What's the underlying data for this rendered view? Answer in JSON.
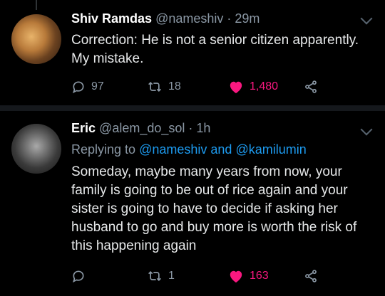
{
  "tweets": [
    {
      "name": "Shiv Ramdas",
      "handle": "@nameshiv",
      "separator": "·",
      "time": "29m",
      "text": "Correction: He is not a senior citizen apparently. My mistake.",
      "reply_count": "97",
      "retweet_count": "18",
      "like_count": "1,480"
    },
    {
      "name": "Eric",
      "handle": "@alem_do_sol",
      "separator": "·",
      "time": "1h",
      "replying_prefix": "Replying to",
      "replying_user1": "@nameshiv",
      "replying_and": "and",
      "replying_user2": "@kamilumin",
      "text": "Someday, maybe many years from now, your family is going to be out of rice again and your sister is going to have to decide if asking her husband to go and buy more is worth the risk of this happening again",
      "reply_count": "",
      "retweet_count": "1",
      "like_count": "163"
    }
  ],
  "colors": {
    "background": "#000000",
    "separator": "#15181c",
    "link": "#1d9bf0",
    "like": "#f91880",
    "muted": "#8b98a5"
  },
  "icons": [
    "reply-icon",
    "retweet-icon",
    "heart-icon",
    "share-icon",
    "more-caret-icon"
  ]
}
